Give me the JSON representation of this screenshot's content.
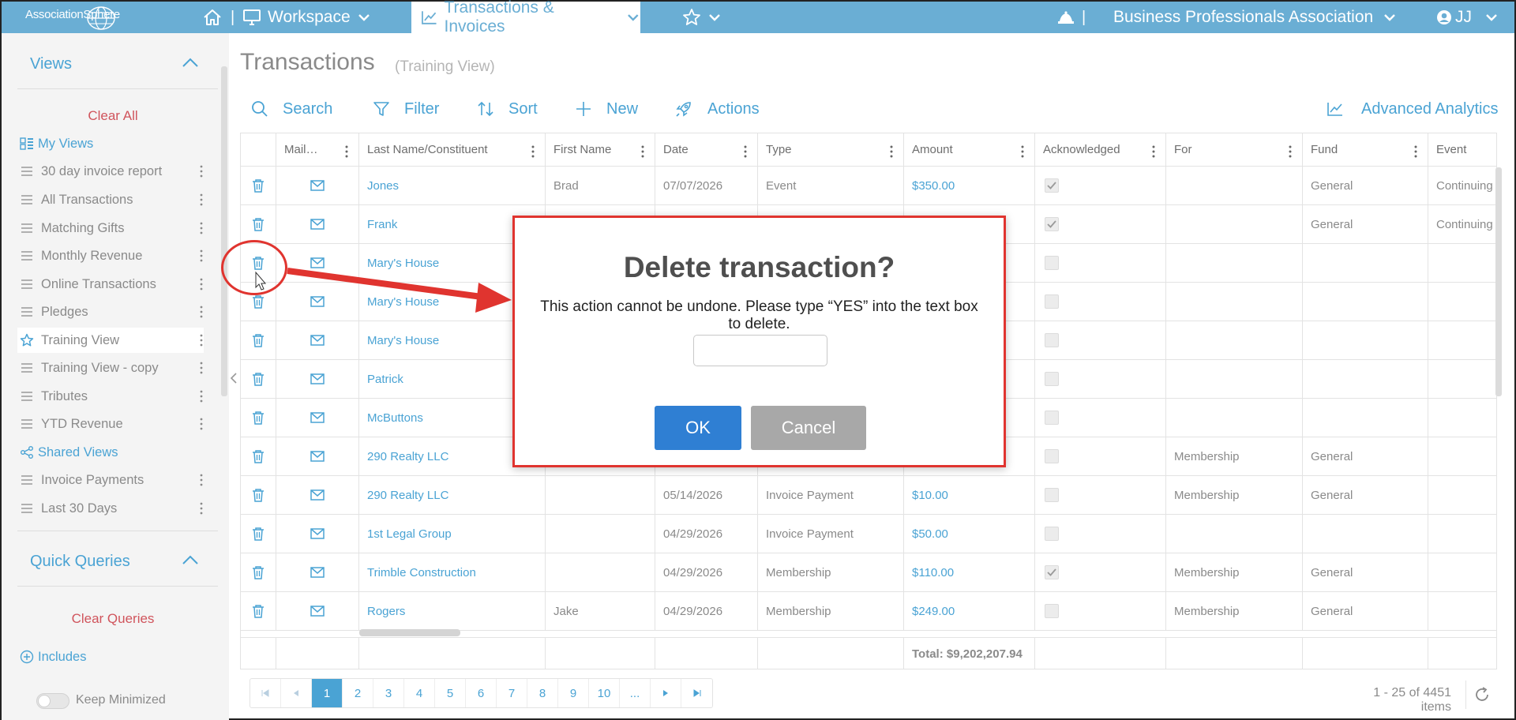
{
  "app": {
    "logo_text": "AssociationSphere",
    "workspace_label": "Workspace",
    "active_tab": "Transactions & Invoices",
    "separator": "|",
    "org_name": "Business Professionals Association",
    "user_initials": "JJ"
  },
  "sidebar": {
    "views_title": "Views",
    "clear_all": "Clear All",
    "my_views_label": "My Views",
    "my_views": [
      {
        "label": "30 day invoice report"
      },
      {
        "label": "All Transactions"
      },
      {
        "label": "Matching Gifts"
      },
      {
        "label": "Monthly Revenue"
      },
      {
        "label": "Online Transactions"
      },
      {
        "label": "Pledges"
      },
      {
        "label": "Training View",
        "selected": true
      },
      {
        "label": "Training View - copy"
      },
      {
        "label": "Tributes"
      },
      {
        "label": "YTD Revenue"
      }
    ],
    "shared_views_label": "Shared Views",
    "shared_views": [
      {
        "label": "Invoice Payments"
      },
      {
        "label": "Last 30 Days"
      }
    ],
    "quick_queries_title": "Quick Queries",
    "clear_queries": "Clear Queries",
    "includes_label": "Includes",
    "keep_minimized_label": "Keep Minimized"
  },
  "page": {
    "title": "Transactions",
    "subtitle": "(Training View)"
  },
  "toolbar": {
    "search": "Search",
    "filter": "Filter",
    "sort": "Sort",
    "new": "New",
    "actions": "Actions",
    "analytics": "Advanced Analytics"
  },
  "grid": {
    "columns": [
      "",
      "Mail…",
      "Last Name/Constituent",
      "First Name",
      "Date",
      "Type",
      "Amount",
      "Acknowledged",
      "For",
      "Fund",
      "Event"
    ],
    "rows": [
      {
        "last": "Jones",
        "first": "Brad",
        "date": "07/07/2026",
        "type": "Event",
        "amount": "$350.00",
        "ack": true,
        "for": "",
        "fund": "General",
        "event": "Continuing Ed"
      },
      {
        "last": "Frank",
        "first": "",
        "date": "",
        "type": "",
        "amount": "",
        "ack": true,
        "for": "",
        "fund": "General",
        "event": "Continuing Ed"
      },
      {
        "last": "Mary's House",
        "first": "",
        "date": "",
        "type": "",
        "amount": "",
        "ack": false,
        "for": "",
        "fund": "",
        "event": ""
      },
      {
        "last": "Mary's House",
        "first": "",
        "date": "",
        "type": "",
        "amount": "",
        "ack": false,
        "for": "",
        "fund": "",
        "event": ""
      },
      {
        "last": "Mary's House",
        "first": "",
        "date": "",
        "type": "",
        "amount": "",
        "ack": false,
        "for": "",
        "fund": "",
        "event": ""
      },
      {
        "last": "Patrick",
        "first": "",
        "date": "",
        "type": "",
        "amount": "",
        "ack": false,
        "for": "",
        "fund": "",
        "event": ""
      },
      {
        "last": "McButtons",
        "first": "",
        "date": "",
        "type": "",
        "amount": "",
        "ack": false,
        "for": "",
        "fund": "",
        "event": ""
      },
      {
        "last": "290 Realty LLC",
        "first": "",
        "date": "",
        "type": "",
        "amount": "",
        "ack": false,
        "for": "Membership",
        "fund": "General",
        "event": ""
      },
      {
        "last": "290 Realty LLC",
        "first": "",
        "date": "05/14/2026",
        "type": "Invoice Payment",
        "amount": "$10.00",
        "ack": false,
        "for": "Membership",
        "fund": "General",
        "event": ""
      },
      {
        "last": "1st Legal Group",
        "first": "",
        "date": "04/29/2026",
        "type": "Invoice Payment",
        "amount": "$50.00",
        "ack": false,
        "for": "",
        "fund": "",
        "event": ""
      },
      {
        "last": "Trimble Construction",
        "first": "",
        "date": "04/29/2026",
        "type": "Membership",
        "amount": "$110.00",
        "ack": true,
        "for": "Membership",
        "fund": "General",
        "event": ""
      },
      {
        "last": "Rogers",
        "first": "Jake",
        "date": "04/29/2026",
        "type": "Membership",
        "amount": "$249.00",
        "ack": false,
        "for": "Membership",
        "fund": "General",
        "event": ""
      }
    ],
    "total": "Total: $9,202,207.94"
  },
  "pager": {
    "pages": [
      "1",
      "2",
      "3",
      "4",
      "5",
      "6",
      "7",
      "8",
      "9",
      "10",
      "..."
    ],
    "current": "1",
    "summary": "1 - 25 of 4451 items"
  },
  "modal": {
    "title": "Delete transaction?",
    "message": "This action cannot be undone. Please type “YES” into the text box to delete.",
    "input_value": "",
    "ok_label": "OK",
    "cancel_label": "Cancel"
  },
  "colors": {
    "topbar": "#6aaed4",
    "accent": "#4aa3d4",
    "danger": "#d0545c",
    "ok_button": "#2f7fd3",
    "cancel_button": "#a8a8a8",
    "annotation": "#e0342f"
  }
}
